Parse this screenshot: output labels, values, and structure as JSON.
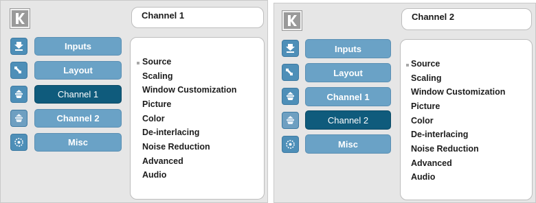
{
  "panels": [
    {
      "title": "Channel 1",
      "menu": [
        {
          "label": "Inputs",
          "icon": "inputs-icon",
          "active": false
        },
        {
          "label": "Layout",
          "icon": "layout-icon",
          "active": false
        },
        {
          "label": "Channel 1",
          "icon": "channel-1-icon",
          "active": true
        },
        {
          "label": "Channel 2",
          "icon": "channel-2-icon",
          "active": false
        },
        {
          "label": "Misc",
          "icon": "misc-icon",
          "active": false
        }
      ],
      "content": [
        "Source",
        "Scaling",
        "Window Customization",
        "Picture",
        "Color",
        "De-interlacing",
        "Noise Reduction",
        "Advanced",
        "Audio"
      ]
    },
    {
      "title": "Channel 2",
      "menu": [
        {
          "label": "Inputs",
          "icon": "inputs-icon",
          "active": false
        },
        {
          "label": "Layout",
          "icon": "layout-icon",
          "active": false
        },
        {
          "label": "Channel 1",
          "icon": "channel-1-icon",
          "active": false
        },
        {
          "label": "Channel 2",
          "icon": "channel-2-icon",
          "active": true
        },
        {
          "label": "Misc",
          "icon": "misc-icon",
          "active": false
        }
      ],
      "content": [
        "Source",
        "Scaling",
        "Window Customization",
        "Picture",
        "Color",
        "De-interlacing",
        "Noise Reduction",
        "Advanced",
        "Audio"
      ]
    }
  ],
  "colors": {
    "panel_bg": "#e6e6e6",
    "button": "#6aa2c6",
    "button_active": "#0f5b7c",
    "icon_bg": "#4e8fb8"
  }
}
